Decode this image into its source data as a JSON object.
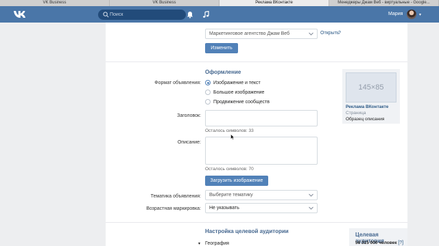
{
  "browser": {
    "tabs": [
      {
        "label": "VK Business",
        "active": false
      },
      {
        "label": "VK Business",
        "active": false
      },
      {
        "label": "Реклама ВКонтакте",
        "active": true
      },
      {
        "label": "Менеджеры Джам Веб - виртуальные - Google...",
        "active": false
      }
    ]
  },
  "header": {
    "logo": "vk",
    "search_placeholder": "Поиск",
    "user_name": "Мария",
    "icons": [
      "search-icon",
      "bell-icon",
      "music-icon"
    ]
  },
  "top": {
    "agency_select_value": "Маркетинговое агентство Джам Веб",
    "open_link": "Открыть",
    "help_mark": "?",
    "change_button": "Изменить"
  },
  "design": {
    "title": "Оформление",
    "format_label": "Формат объявления:",
    "options": [
      {
        "label": "Изображение и текст",
        "checked": true
      },
      {
        "label": "Большое изображение",
        "checked": false
      },
      {
        "label": "Продвижение сообществ",
        "checked": false
      }
    ],
    "headline_label": "Заголовок:",
    "headline_value": "",
    "headline_hint": "Осталось символов: 33",
    "description_label": "Описание:",
    "description_value": "",
    "description_hint": "Осталось символов: 70",
    "upload_button": "Загрузить изображение",
    "topic_label": "Тематика объявления:",
    "topic_value": "Выберите тематику",
    "age_label": "Возрастная маркировка:",
    "age_value": "Не указывать"
  },
  "preview": {
    "image_text": "145×85",
    "title": "Реклама ВКонтакте",
    "subtitle": "Страница",
    "description": "Образец описания"
  },
  "targeting": {
    "title": "Настройка целевой аудитории",
    "geo_label": "География",
    "audience_title": "Целевая аудитория",
    "audience_count": "56 315 000 человек",
    "audience_help": "[?]"
  }
}
